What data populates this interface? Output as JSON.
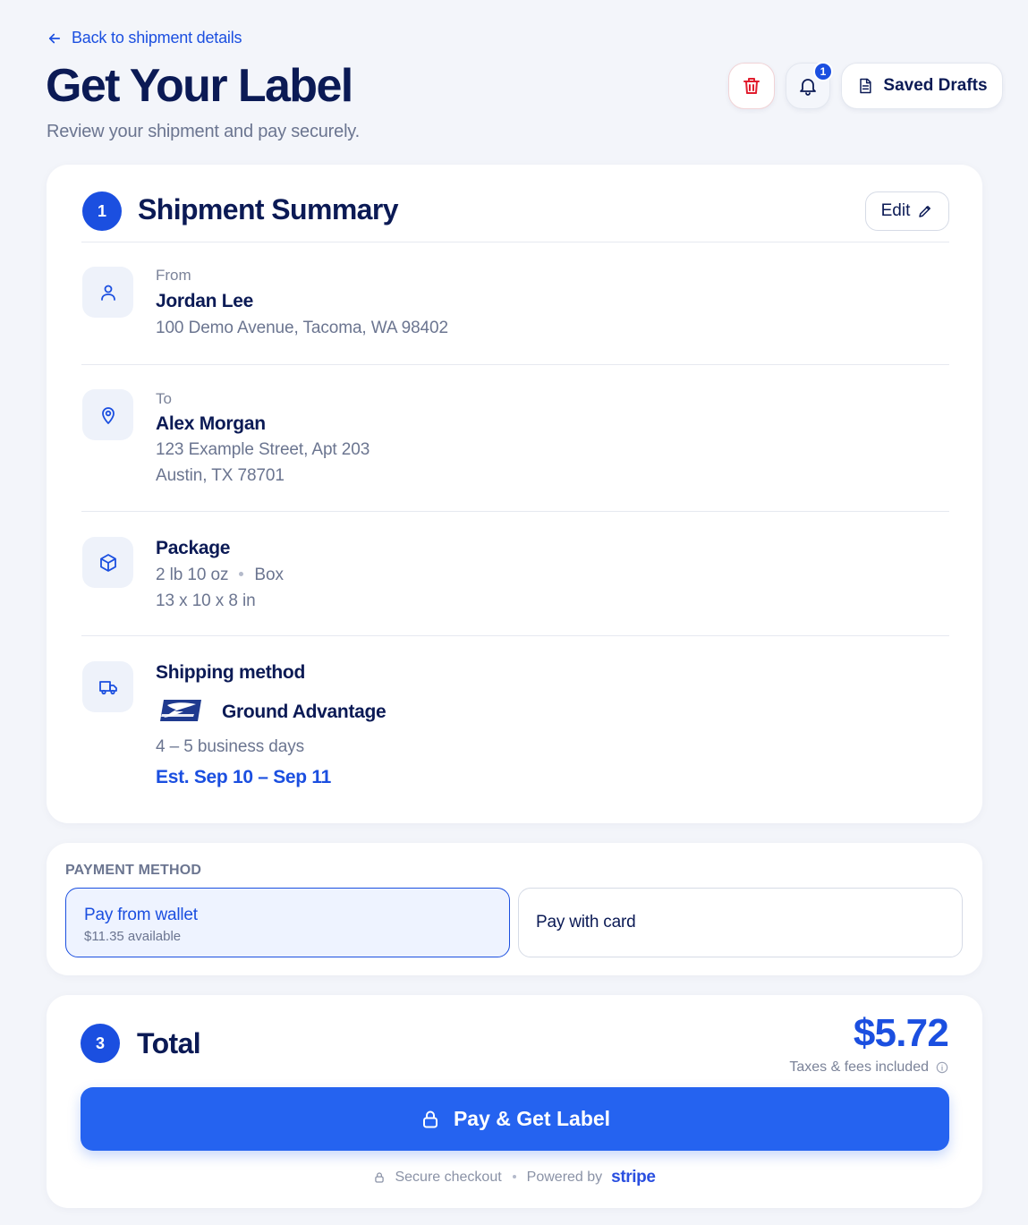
{
  "header": {
    "back_label": "Back to shipment details",
    "title": "Get Your Label",
    "subtitle": "Review your shipment and pay securely.",
    "notification_count": "1",
    "saved_drafts_label": "Saved Drafts"
  },
  "summary": {
    "step": "1",
    "title": "Shipment Summary",
    "edit_label": "Edit",
    "from": {
      "label": "From",
      "name": "Jordan Lee",
      "address": "100 Demo Avenue, Tacoma, WA 98402"
    },
    "to": {
      "label": "To",
      "name": "Alex Morgan",
      "address_line1": "123 Example Street, Apt 203",
      "address_line2": "Austin, TX 78701"
    },
    "package": {
      "title": "Package",
      "weight": "2 lb 10 oz",
      "type": "Box",
      "dimensions": "13 x 10 x 8 in"
    },
    "shipping": {
      "title": "Shipping method",
      "service": "Ground Advantage",
      "transit": "4 – 5 business days",
      "estimate": "Est. Sep 10 – Sep 11"
    }
  },
  "payment": {
    "label": "PAYMENT METHOD",
    "wallet_title": "Pay from wallet",
    "wallet_available": "$11.35 available",
    "card_title": "Pay with card",
    "selected": "wallet"
  },
  "total": {
    "step": "3",
    "title": "Total",
    "amount": "$5.72",
    "tax_note": "Taxes & fees included",
    "pay_label": "Pay & Get Label",
    "secure_label": "Secure checkout",
    "powered_label": "Powered by",
    "stripe_label": "stripe"
  },
  "colors": {
    "accent": "#1b4fe0",
    "button": "#2563f0",
    "danger": "#e11d2e",
    "background": "#f3f5fa"
  }
}
